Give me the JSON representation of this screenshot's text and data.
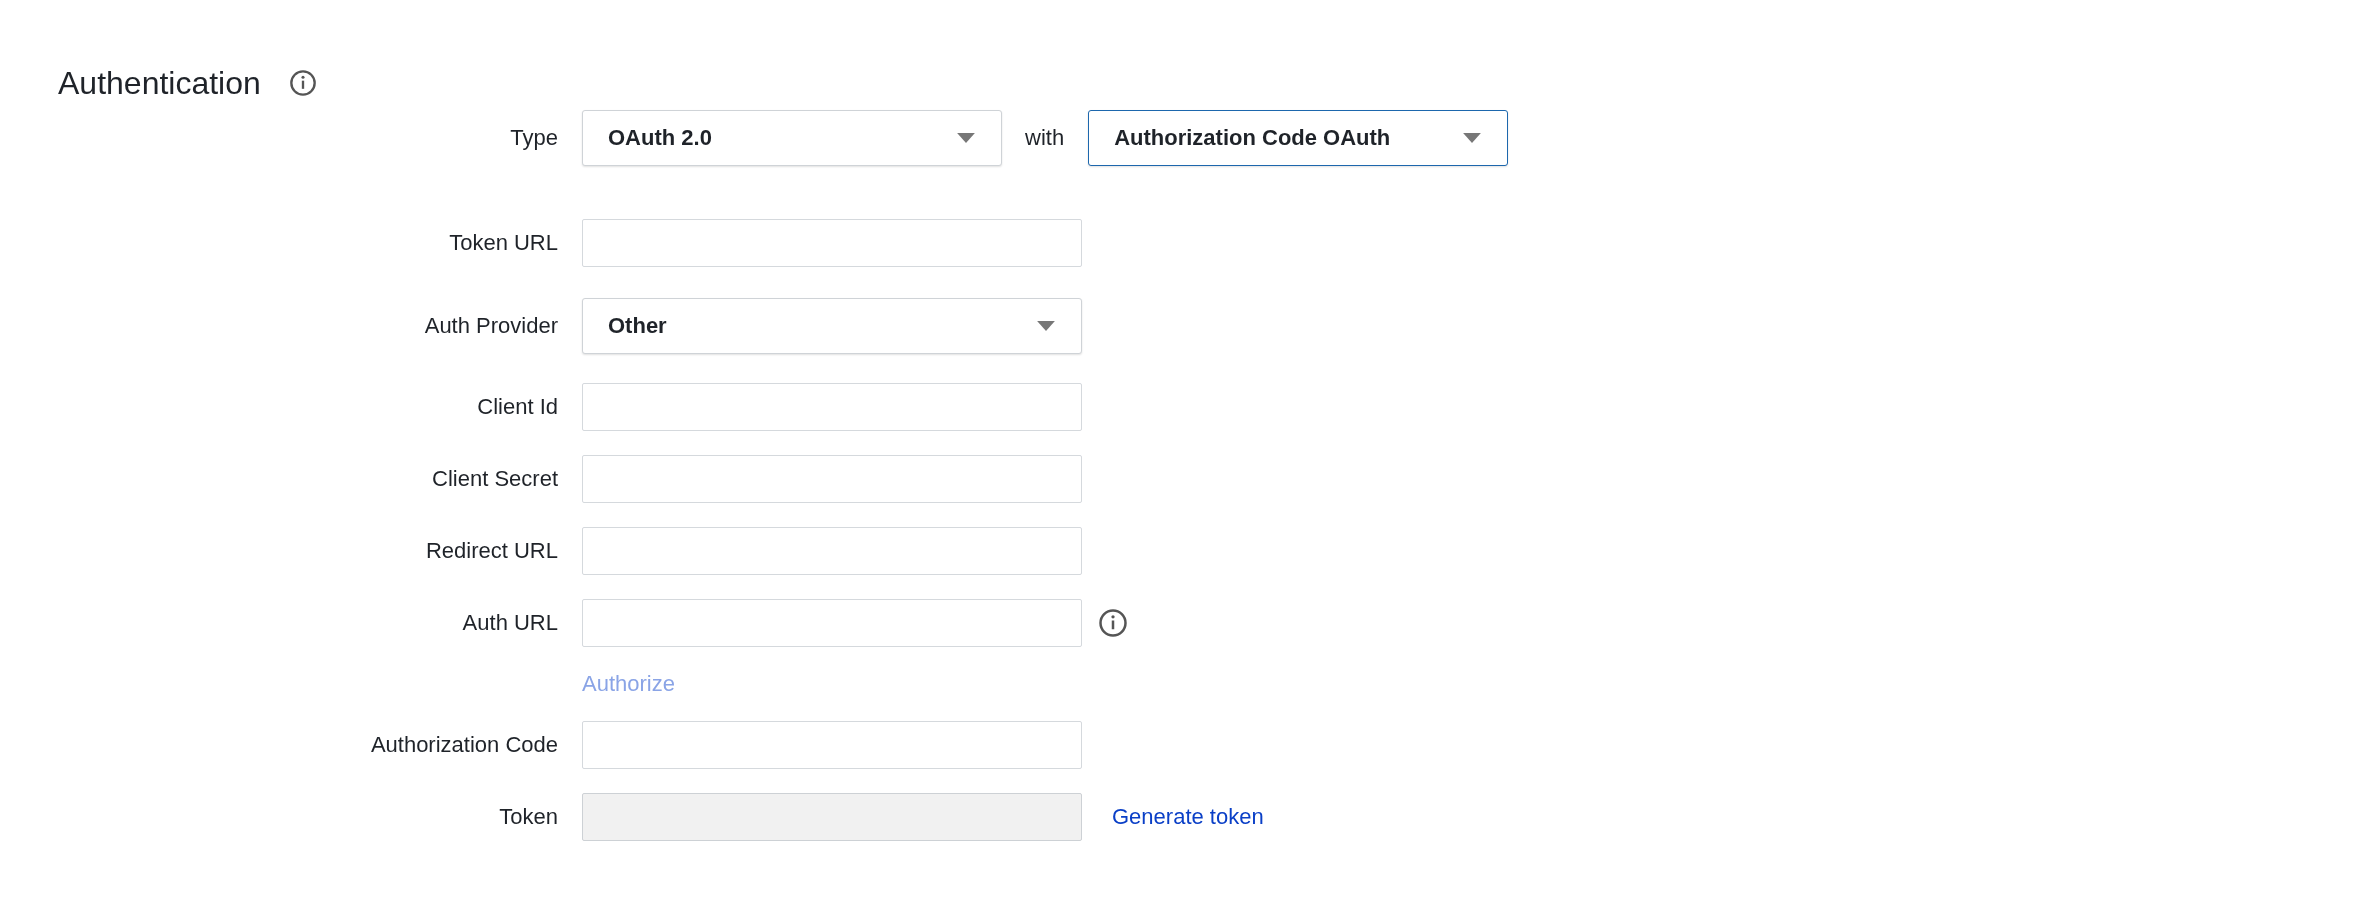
{
  "section": {
    "title": "Authentication"
  },
  "fields": [
    {
      "kind": "select-pair",
      "label": "Type",
      "value": "OAuth 2.0",
      "focused": false,
      "joiner": "with",
      "second": {
        "value": "Authorization Code OAuth",
        "focused": true
      }
    },
    {
      "kind": "text",
      "label": "Token URL"
    },
    {
      "kind": "select",
      "label": "Auth Provider",
      "value": "Other",
      "focused": false
    },
    {
      "kind": "text",
      "label": "Client Id"
    },
    {
      "kind": "text",
      "label": "Client Secret"
    },
    {
      "kind": "text",
      "label": "Redirect URL"
    },
    {
      "kind": "text",
      "label": "Auth URL",
      "info": true
    },
    {
      "kind": "link",
      "label": "Authorize",
      "disabled": true
    },
    {
      "kind": "text",
      "label": "Authorization Code"
    },
    {
      "kind": "text",
      "label": "Token",
      "disabled": true,
      "action": "Generate token"
    }
  ]
}
